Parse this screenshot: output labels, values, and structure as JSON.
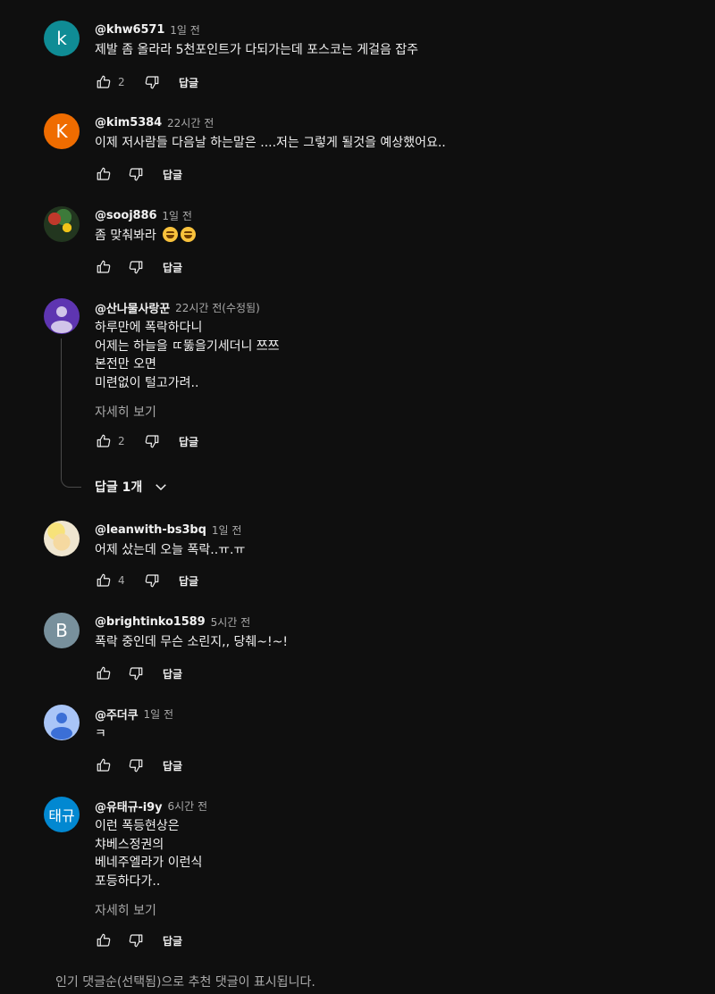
{
  "comments": [
    {
      "author": "@khw6571",
      "time": "1일 전",
      "lines": [
        "제발 좀 올라라 5천포인트가 다되가는데 포스코는 게걸음 잡주"
      ],
      "likes": "2",
      "reply": "답글",
      "avatar": {
        "text": "k",
        "color": "#0f8c95"
      }
    },
    {
      "author": "@kim5384",
      "time": "22시간 전",
      "lines": [
        "이제 저사람들 다음날 하는말은 ....저는 그렇게 될것을 예상했어요.."
      ],
      "likes": "",
      "reply": "답글",
      "avatar": {
        "text": "K",
        "color": "#ef6c00"
      }
    },
    {
      "author": "@sooj886",
      "time": "1일 전",
      "lines": [
        "좀 맞춰봐라"
      ],
      "likes": "",
      "reply": "답글",
      "avatar": {
        "text": "",
        "color": "#2d4a2a"
      }
    },
    {
      "author": "@산나물사랑꾼",
      "time": "22시간 전(수정됨)",
      "lines": [
        "하루만에 폭락하다니",
        "어제는 하늘을 ㄸ뚫을기세더니 쯔쯔",
        "본전만 오면",
        "미련없이 털고가려.."
      ],
      "more": "자세히 보기",
      "likes": "2",
      "reply": "답글",
      "avatar": {
        "text": "",
        "color": "#5e35b1"
      },
      "replies_toggle": "답글 1개"
    },
    {
      "author": "@leanwith-bs3bq",
      "time": "1일 전",
      "lines": [
        "어제 샀는데 오늘 폭락..ㅠ.ㅠ"
      ],
      "likes": "4",
      "reply": "답글",
      "avatar": {
        "text": "",
        "color": "#e8dcc0"
      }
    },
    {
      "author": "@brightinko1589",
      "time": "5시간 전",
      "lines": [
        "폭락 중인데 무슨 소린지,, 당췌~!~!"
      ],
      "likes": "",
      "reply": "답글",
      "avatar": {
        "text": "B",
        "color": "#78909c"
      }
    },
    {
      "author": "@주더쿠",
      "time": "1일 전",
      "lines": [
        "ㅋ"
      ],
      "likes": "",
      "reply": "답글",
      "avatar": {
        "text": "",
        "color": "#a9c5f7"
      }
    },
    {
      "author": "@유태규-i9y",
      "time": "6시간 전",
      "lines": [
        "이런 폭등현상은",
        "챠베스정권의",
        "베네주엘라가 이런식",
        "포등하다가.."
      ],
      "more": "자세히 보기",
      "likes": "",
      "reply": "답글",
      "avatar": {
        "text": "태규",
        "color": "#0288d1"
      }
    }
  ],
  "footer": "인기 댓글순(선택됨)으로 추천 댓글이 표시됩니다.",
  "icons": {
    "like": "thumbs-up-icon",
    "dislike": "thumbs-down-icon",
    "expand": "chevron-down-icon",
    "emoji": "laughing-emoji-icon"
  }
}
